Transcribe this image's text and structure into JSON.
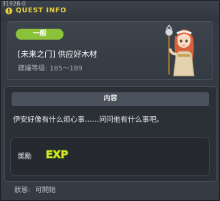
{
  "window": {
    "quest_id": "31928-0",
    "title": "QUEST INFO"
  },
  "quest": {
    "category_badge": "一般",
    "name": "[未来之门] 供应好木材",
    "level_label": "建議等级:",
    "level_range": "185～189"
  },
  "content": {
    "header": "内容",
    "description": "伊安好像有什么烦心事……问问他有什么事吧。"
  },
  "reward": {
    "label": "獎勵",
    "exp_icon_text": "EXP"
  },
  "status": {
    "label": "狀態:",
    "value": "可開始"
  },
  "colors": {
    "badge_green": "#8cc23a",
    "title_yellow": "#e8cf3a",
    "exp_yellow": "#e6e021",
    "exp_outline": "#4a8f1a"
  }
}
